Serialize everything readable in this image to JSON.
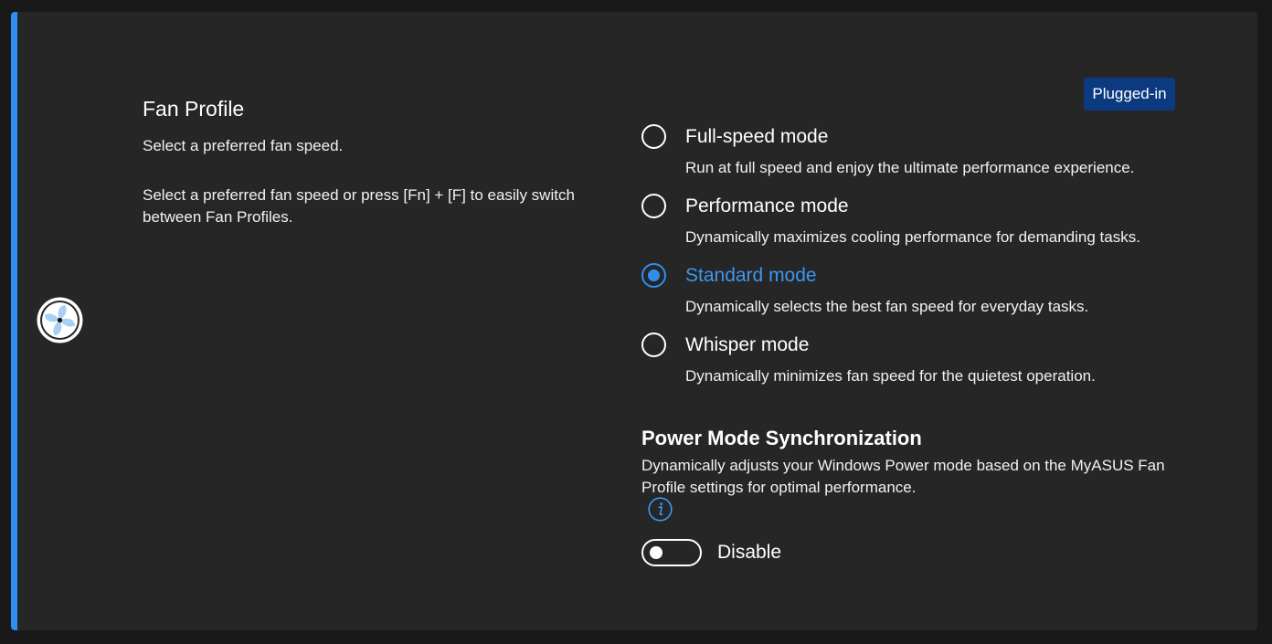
{
  "fan_profile": {
    "title": "Fan Profile",
    "subtitle": "Select a preferred fan speed.",
    "hint": "Select a preferred fan speed or press [Fn] + [F]  to easily switch between Fan Profiles.",
    "icon": "fan-icon"
  },
  "power_source_badge": "Plugged-in",
  "modes": [
    {
      "label": "Full-speed mode",
      "description": "Run at full speed and enjoy the ultimate performance experience.",
      "selected": false
    },
    {
      "label": "Performance mode",
      "description": "Dynamically maximizes cooling performance for demanding tasks.",
      "selected": false
    },
    {
      "label": "Standard mode",
      "description": "Dynamically selects the best fan speed for everyday tasks.",
      "selected": true
    },
    {
      "label": "Whisper mode",
      "description": "Dynamically minimizes fan speed for the quietest operation.",
      "selected": false
    }
  ],
  "power_sync": {
    "title": "Power Mode Synchronization",
    "description": "Dynamically adjusts your Windows Power mode based on the MyASUS Fan Profile settings for optimal performance.",
    "info_icon": "info-icon",
    "toggle_label": "Disable",
    "toggle_on": false
  },
  "colors": {
    "accent": "#2f8ff0",
    "badge_bg": "#0b3a80",
    "card_bg": "#262626",
    "page_bg": "#191919"
  }
}
